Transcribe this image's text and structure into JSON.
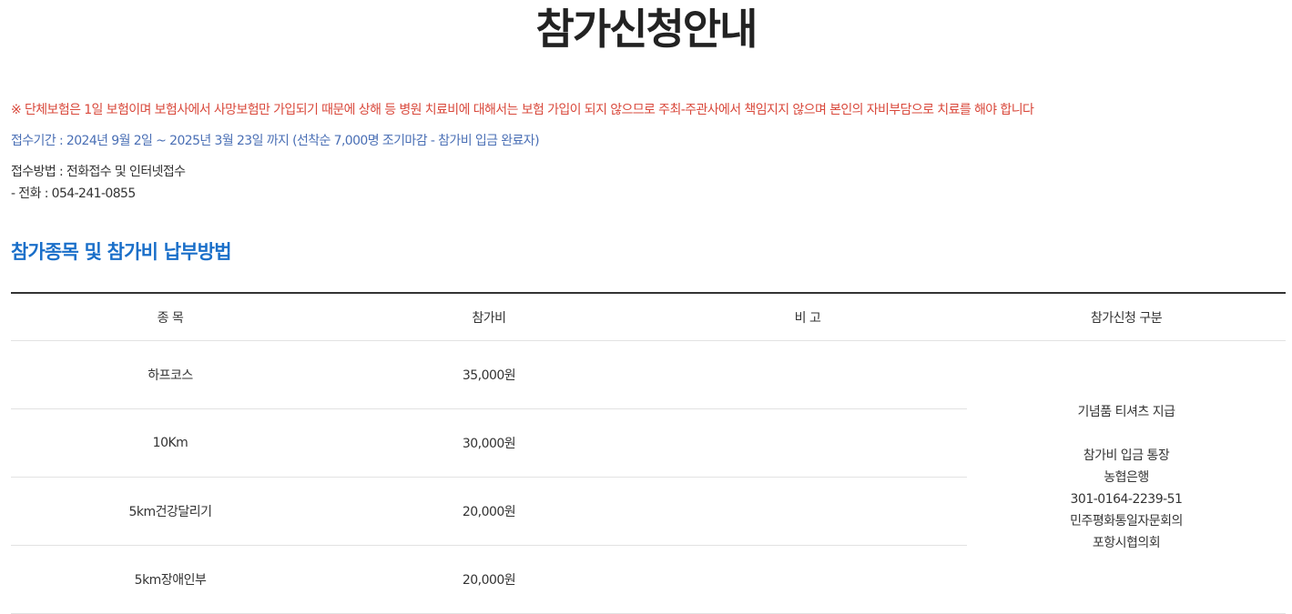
{
  "title": "참가신청안내",
  "notices": {
    "insurance": "※ 단체보험은 1일 보험이며 보험사에서 사망보험만 가입되기 때문에 상해 등 병원 치료비에 대해서는 보험 가입이 되지 않으므로 주최-주관사에서 책임지지 않으며 본인의 자비부담으로 치료를 해야 합니다",
    "period": "접수기간 : 2024년 9월 2일 ~ 2025년 3월 23일 까지 (선착순 7,000명 조기마감 - 참가비 입금 완료자)",
    "method": "접수방법 : 전화접수 및 인터넷접수",
    "phone": "- 전화 : 054-241-0855"
  },
  "section": {
    "title": "참가종목 및 참가비 납부방법"
  },
  "table": {
    "headers": [
      "종 목",
      "참가비",
      "비 고",
      "참가신청 구분"
    ],
    "rows": [
      {
        "event": "하프코스",
        "fee": "35,000원",
        "note": ""
      },
      {
        "event": "10Km",
        "fee": "30,000원",
        "note": ""
      },
      {
        "event": "5km건강달리기",
        "fee": "20,000원",
        "note": ""
      },
      {
        "event": "5km장애인부",
        "fee": "20,000원",
        "note": ""
      }
    ],
    "category": {
      "gift": "기념품 티셔츠 지급",
      "account_title": "참가비 입금 통장",
      "bank": "농협은행",
      "account_number": "301-0164-2239-51",
      "holder_line1": "민주평화통일자문회의",
      "holder_line2": "포항시협의회"
    }
  }
}
